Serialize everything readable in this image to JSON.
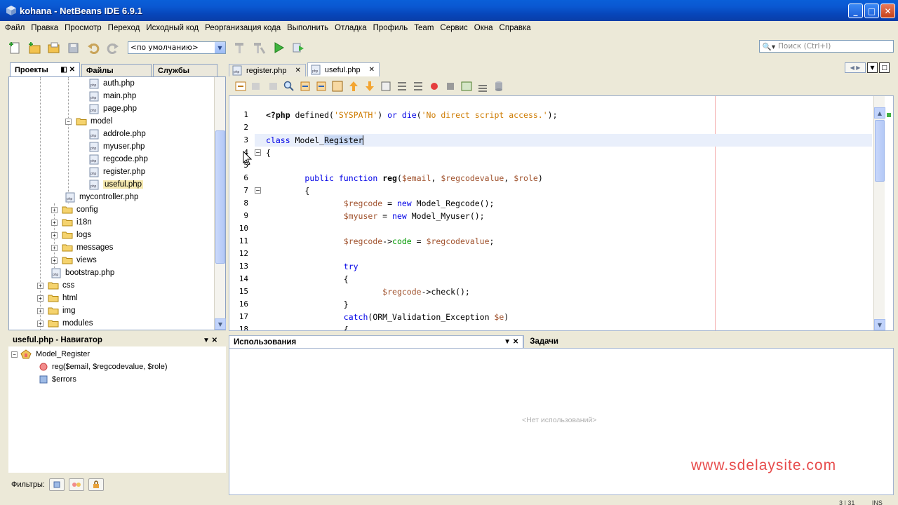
{
  "window": {
    "title": "kohana - NetBeans IDE 6.9.1"
  },
  "menu": [
    "Файл",
    "Правка",
    "Просмотр",
    "Переход",
    "Исходный код",
    "Реорганизация кода",
    "Выполнить",
    "Отладка",
    "Профиль",
    "Team",
    "Сервис",
    "Окна",
    "Справка"
  ],
  "toolbar": {
    "config_value": "<по умолчанию>",
    "search_placeholder": "Поиск (Ctrl+I)"
  },
  "project_tabs": [
    "Проекты",
    "Файлы",
    "Службы"
  ],
  "tree": [
    {
      "label": "auth.php",
      "type": "file",
      "level": 5
    },
    {
      "label": "main.php",
      "type": "file",
      "level": 5
    },
    {
      "label": "page.php",
      "type": "file",
      "level": 5
    },
    {
      "label": "model",
      "type": "folder",
      "level": 4,
      "expanded": true
    },
    {
      "label": "addrole.php",
      "type": "file",
      "level": 5
    },
    {
      "label": "myuser.php",
      "type": "file",
      "level": 5
    },
    {
      "label": "regcode.php",
      "type": "file",
      "level": 5
    },
    {
      "label": "register.php",
      "type": "file",
      "level": 5
    },
    {
      "label": "useful.php",
      "type": "file",
      "level": 5,
      "selected": true
    },
    {
      "label": "mycontroller.php",
      "type": "file",
      "level": 4
    },
    {
      "label": "config",
      "type": "folder",
      "level": 3
    },
    {
      "label": "i18n",
      "type": "folder",
      "level": 3
    },
    {
      "label": "logs",
      "type": "folder",
      "level": 3
    },
    {
      "label": "messages",
      "type": "folder",
      "level": 3
    },
    {
      "label": "views",
      "type": "folder",
      "level": 3
    },
    {
      "label": "bootstrap.php",
      "type": "file",
      "level": 3
    },
    {
      "label": "css",
      "type": "folder",
      "level": 2
    },
    {
      "label": "html",
      "type": "folder",
      "level": 2
    },
    {
      "label": "img",
      "type": "folder",
      "level": 2
    },
    {
      "label": "modules",
      "type": "folder",
      "level": 2
    }
  ],
  "editor_tabs": [
    {
      "label": "register.php",
      "active": false
    },
    {
      "label": "useful.php",
      "active": true
    }
  ],
  "code_lines": [
    {
      "n": "1",
      "html": "<span class=\"bold\">&lt;?php</span> defined(<span class=\"str\">'SYSPATH'</span>) <span class=\"kw\">or</span> <span class=\"kw\">die</span>(<span class=\"str\">'No direct script access.'</span>);"
    },
    {
      "n": "2",
      "html": ""
    },
    {
      "n": "3",
      "html": "<span class=\"kw\">class</span> Model_Register"
    },
    {
      "n": "4",
      "html": "{"
    },
    {
      "n": "5",
      "html": ""
    },
    {
      "n": "6",
      "html": "        <span class=\"kw\">public</span> <span class=\"kw\">function</span> <span class=\"bold\">reg</span>(<span class=\"var\">$email</span>, <span class=\"var\">$regcodevalue</span>, <span class=\"var\">$role</span>)"
    },
    {
      "n": "7",
      "html": "        {"
    },
    {
      "n": "8",
      "html": "                <span class=\"var\">$regcode</span> = <span class=\"kw\">new</span> Model_Regcode();"
    },
    {
      "n": "9",
      "html": "                <span class=\"var\">$myuser</span> = <span class=\"kw\">new</span> Model_Myuser();"
    },
    {
      "n": "10",
      "html": ""
    },
    {
      "n": "11",
      "html": "                <span class=\"var\">$regcode</span>-&gt;<span class=\"field\">code</span> = <span class=\"var\">$regcodevalue</span>;"
    },
    {
      "n": "12",
      "html": ""
    },
    {
      "n": "13",
      "html": "                <span class=\"kw\">try</span>"
    },
    {
      "n": "14",
      "html": "                {"
    },
    {
      "n": "15",
      "html": "                        <span class=\"var\">$regcode</span>-&gt;check();"
    },
    {
      "n": "16",
      "html": "                }"
    },
    {
      "n": "17",
      "html": "                <span class=\"kw\">catch</span>(ORM_Validation_Exception <span class=\"var\">$e</span>)"
    },
    {
      "n": "18",
      "html": "                {"
    }
  ],
  "navigator": {
    "title": "useful.php - Навигатор",
    "class_name": "Model_Register",
    "method": "reg($email, $regcodevalue, $role)",
    "field": "$errors",
    "filters_label": "Фильтры:"
  },
  "output": {
    "usages_tab": "Использования",
    "tasks_tab": "Задачи",
    "empty_text": "<Нет использований>"
  },
  "watermark": "www.sdelaysite.com",
  "status": {
    "position": "3 | 31",
    "mode": "INS"
  }
}
